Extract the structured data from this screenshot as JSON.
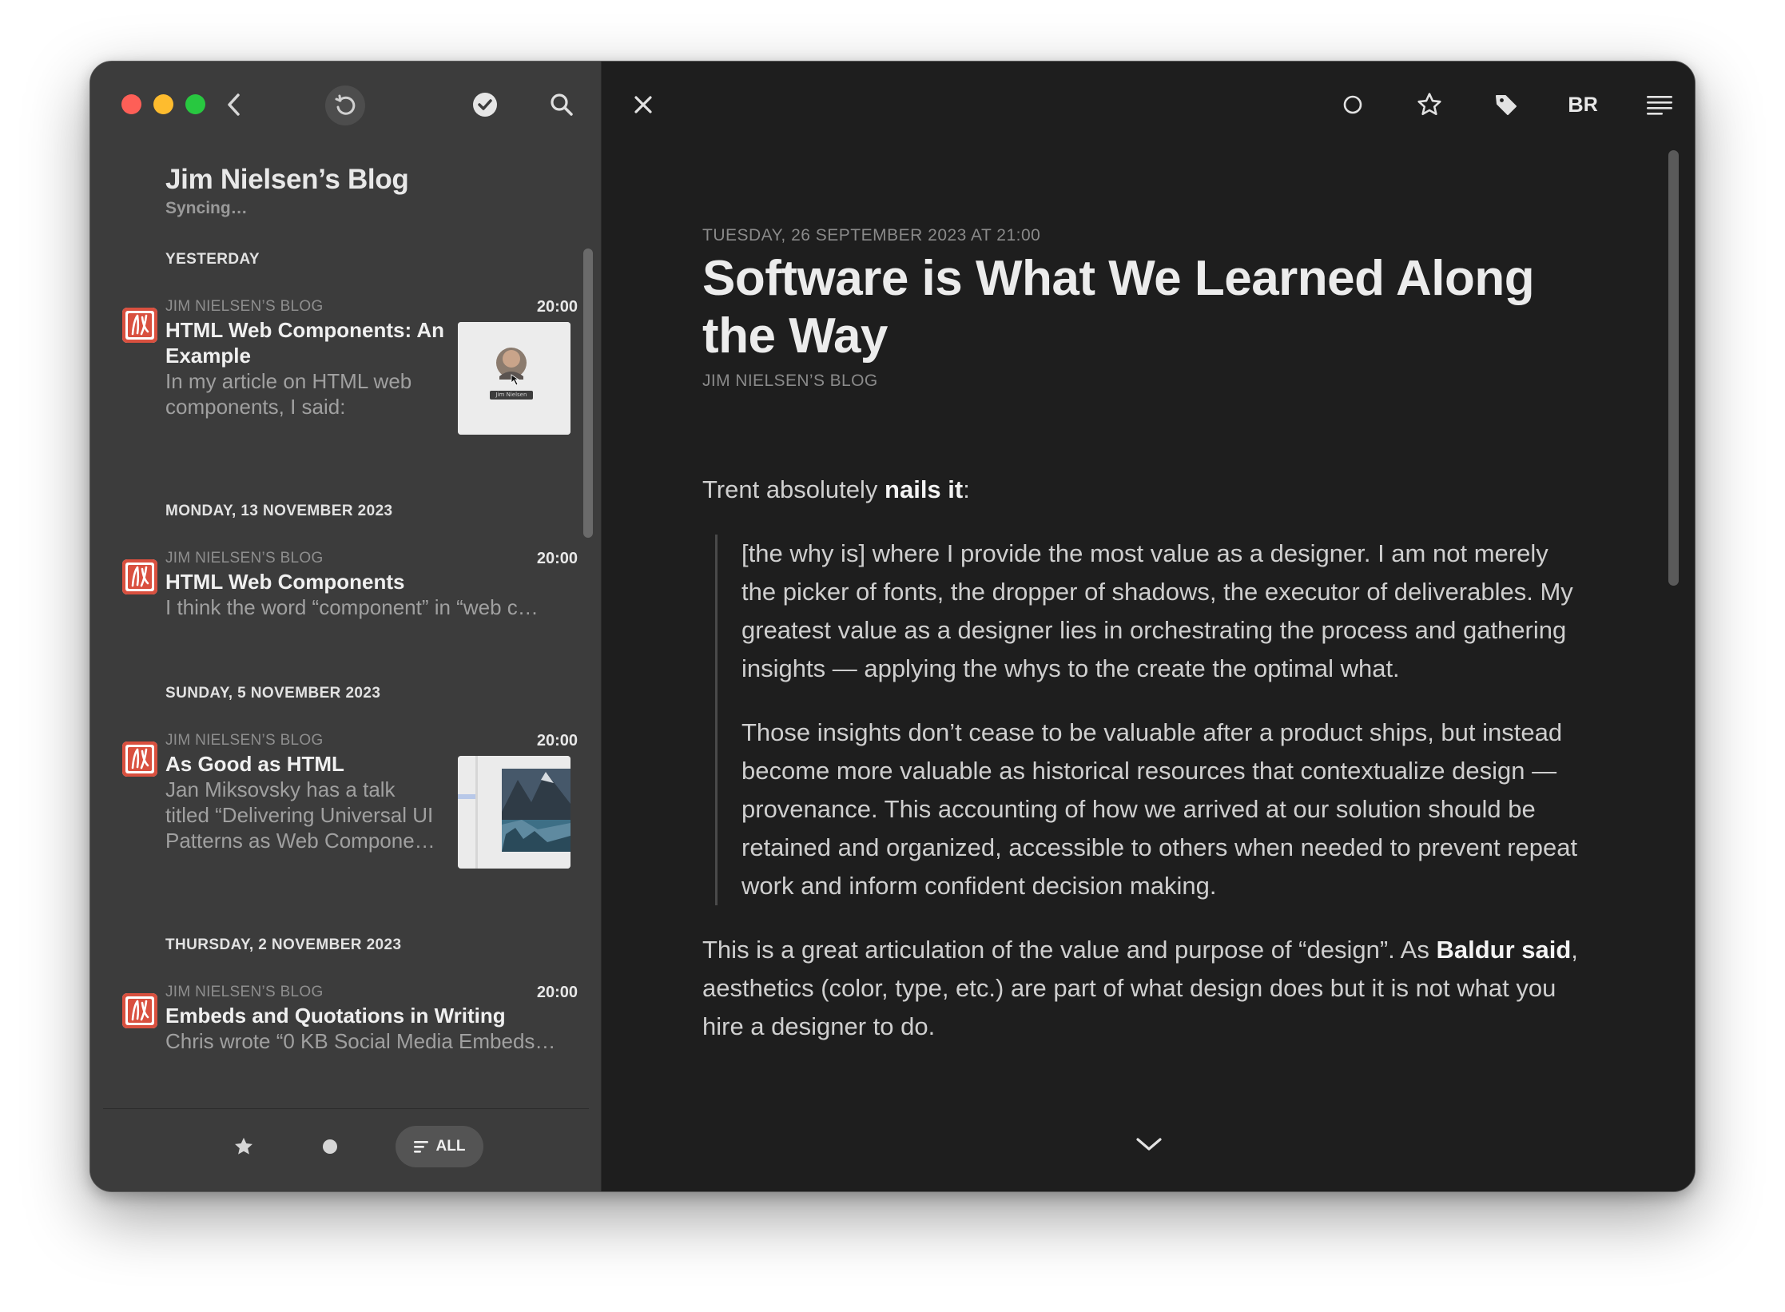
{
  "sidebar": {
    "feed_title": "Jim Nielsen’s Blog",
    "status": "Syncing…",
    "groups": [
      {
        "date": "YESTERDAY",
        "articles": [
          {
            "source": "JIM NIELSEN’S BLOG",
            "time": "20:00",
            "title_lines": [
              "HTML Web Components: An",
              "Example"
            ],
            "excerpt_lines": [
              "In my article on HTML web",
              "components, I said:"
            ],
            "thumb_caption": "Jim Nielsen"
          }
        ]
      },
      {
        "date": "MONDAY, 13 NOVEMBER 2023",
        "articles": [
          {
            "source": "JIM NIELSEN’S BLOG",
            "time": "20:00",
            "title_lines": [
              "HTML Web Components"
            ],
            "excerpt_lines": [
              "I think the word “component” in “web c…"
            ]
          }
        ]
      },
      {
        "date": "SUNDAY, 5 NOVEMBER 2023",
        "articles": [
          {
            "source": "JIM NIELSEN’S BLOG",
            "time": "20:00",
            "title_lines": [
              "As Good as HTML"
            ],
            "excerpt_lines": [
              "Jan Miksovsky has a talk",
              "titled “Delivering Universal UI",
              "Patterns as Web Compone…"
            ]
          }
        ]
      },
      {
        "date": "THURSDAY, 2 NOVEMBER 2023",
        "articles": [
          {
            "source": "JIM NIELSEN’S BLOG",
            "time": "20:00",
            "title_lines": [
              "Embeds and Quotations in Writing"
            ],
            "excerpt_lines": [
              "Chris wrote “0 KB Social Media Embeds…"
            ]
          }
        ]
      }
    ],
    "bottom_bar": {
      "all_label": "ALL"
    }
  },
  "toolbar": {
    "bionic_reading_label_b": "B",
    "bionic_reading_label_r": "R"
  },
  "article": {
    "date": "TUESDAY, 26 SEPTEMBER 2023 AT 21:00",
    "title": "Software is What We Learned Along the Way",
    "byline": "JIM NIELSEN’S BLOG",
    "intro_text": "Trent absolutely ",
    "intro_bold": "nails it",
    "intro_end": ":",
    "quote_1": "[the why is] where I provide the most value as a designer. I am not merely the picker of fonts, the dropper of shadows, the executor of deliverables. My greatest value as a designer lies in orchestrating the process and gathering insights — applying the whys to the create the optimal what.",
    "quote_2": "Those insights don’t cease to be valuable after a product ships, but instead become more valuable as historical resources that contextualize design — provenance. This accounting of how we arrived at our solution should be retained and organized, accessible to others when needed to prevent repeat work and inform confident decision making.",
    "para_start": "This is a great articulation of the value and purpose of “design”. As ",
    "para_bold": "Baldur said",
    "para_end": ", aesthetics (color, type, etc.) are part of what design does but it is not what you hire a designer to do."
  },
  "colors": {
    "sidebar_bg": "#3c3c3c",
    "reader_bg": "#1e1e1e",
    "favicon_red": "#d9503f"
  }
}
